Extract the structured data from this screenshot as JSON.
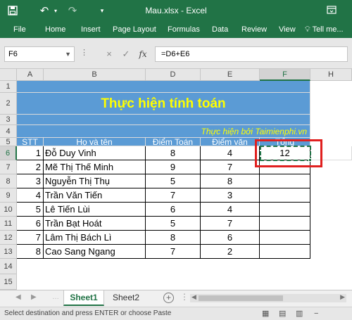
{
  "titlebar": {
    "title": "Mau.xlsx - Excel",
    "save_icon": "save-icon",
    "undo_icon": "undo-icon",
    "redo_icon": "redo-icon"
  },
  "ribbon": {
    "tabs": [
      "File",
      "Home",
      "Insert",
      "Page Layout",
      "Formulas",
      "Data",
      "Review",
      "View"
    ],
    "tell_me": "Tell me..."
  },
  "formula_bar": {
    "name_box": "F6",
    "cancel": "×",
    "enter": "✓",
    "fx": "fx",
    "formula": "=D6+E6"
  },
  "grid": {
    "columns": [
      "A",
      "B",
      "D",
      "E",
      "F",
      "H"
    ],
    "selected_column": "F",
    "rows": [
      "1",
      "2",
      "3",
      "4",
      "5",
      "6",
      "7",
      "8",
      "9",
      "10",
      "11",
      "12",
      "13",
      "14",
      "15"
    ],
    "selected_row": "6",
    "banner_title": "Thực hiện tính toán",
    "byline": "Thực hiện bởi Taimienphi.vn",
    "headers": [
      "STT",
      "Họ và tên",
      "Điểm Toán",
      "Điểm văn",
      "Tổng"
    ],
    "records": [
      {
        "stt": "1",
        "name": "Đỗ Duy Vinh",
        "math": "8",
        "lit": "4",
        "total": "12"
      },
      {
        "stt": "2",
        "name": "Mẽ Thị Thế Minh",
        "math": "9",
        "lit": "7",
        "total": ""
      },
      {
        "stt": "3",
        "name": "Nguyễn Thị Thụ",
        "math": "5",
        "lit": "8",
        "total": ""
      },
      {
        "stt": "4",
        "name": "Trần Văn Tiến",
        "math": "7",
        "lit": "3",
        "total": ""
      },
      {
        "stt": "5",
        "name": "Lê Tiến Lùi",
        "math": "6",
        "lit": "4",
        "total": ""
      },
      {
        "stt": "6",
        "name": "Trần Bạt Hoát",
        "math": "5",
        "lit": "7",
        "total": ""
      },
      {
        "stt": "7",
        "name": "Lâm Thị Bách Lì",
        "math": "8",
        "lit": "6",
        "total": ""
      },
      {
        "stt": "8",
        "name": "Cao Sang Ngang",
        "math": "7",
        "lit": "2",
        "total": ""
      }
    ]
  },
  "sheets": {
    "tabs": [
      "Sheet1",
      "Sheet2"
    ],
    "active": "Sheet1",
    "add": "+"
  },
  "status": {
    "message": "Select destination and press ENTER or choose Paste"
  },
  "colors": {
    "excel_green": "#217346",
    "table_blue": "#5b9bd5",
    "banner_text": "#ffff00",
    "highlight_red": "#e0201f"
  }
}
